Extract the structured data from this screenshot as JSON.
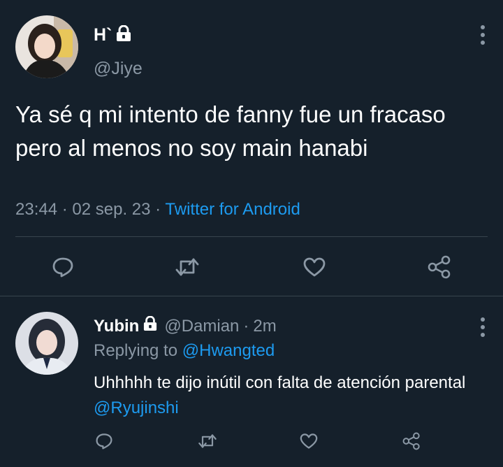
{
  "main_tweet": {
    "display_name": "H`",
    "handle": "@Jiye",
    "text": "Ya sé q mi intento de fanny fue un fracaso pero al menos no soy main hanabi",
    "time": "23:44",
    "date": "02 sep. 23",
    "separator": "·",
    "source": "Twitter for Android",
    "protected_icon": "lock-icon",
    "actions": [
      "reply-icon",
      "retweet-icon",
      "like-icon",
      "share-icon"
    ]
  },
  "reply": {
    "display_name": "Yubin",
    "handle": "@Damian",
    "separator": "·",
    "age": "2m",
    "replying_prefix": "Replying to",
    "replying_to": "@Hwangted",
    "text": "Uhhhhh te dijo inútil con falta de atención parental",
    "mention": "@Ryujinshi",
    "protected_icon": "lock-icon",
    "actions": [
      "reply-icon",
      "retweet-icon",
      "like-icon",
      "share-icon"
    ]
  },
  "colors": {
    "background": "#15202b",
    "text": "#ffffff",
    "secondary": "#8b98a5",
    "link": "#1d9bf0",
    "divider": "#38444d"
  }
}
